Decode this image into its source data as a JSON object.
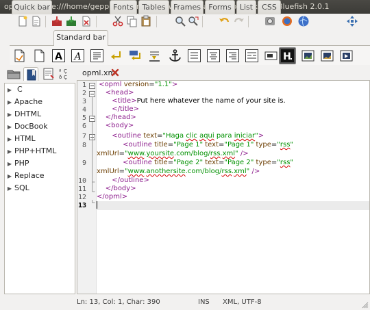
{
  "window": {
    "title": "opml.xml (file:///home/geppettys/Dropbox/WWW/canal9/ncr/opml.xml) - Bluefish 2.0.1"
  },
  "toolbar": {
    "icons": [
      "new-file-icon",
      "open-file-icon",
      "save-icon",
      "save-as-icon",
      "close-file-icon",
      "cut-icon",
      "copy-icon",
      "paste-icon",
      "find-icon",
      "find-replace-icon",
      "undo-icon",
      "redo-icon",
      "preferences-icon",
      "browser-preview-icon",
      "fullscreen-icon"
    ]
  },
  "tabs": [
    {
      "label": "Quick bar"
    },
    {
      "label": "Standard bar"
    },
    {
      "label": "Fonts"
    },
    {
      "label": "Tables"
    },
    {
      "label": "Frames"
    },
    {
      "label": "Forms"
    },
    {
      "label": "List"
    },
    {
      "label": "CSS"
    }
  ],
  "active_tab": "Standard bar",
  "htmlbar": {
    "icons": [
      "quickstart-icon",
      "body-icon",
      "bold-icon",
      "italic-icon",
      "paragraph-icon",
      "break-icon",
      "break-clear-icon",
      "nbsp-icon",
      "anchor-icon",
      "rule-icon",
      "center-icon",
      "right-icon",
      "comment-icon",
      "email-icon",
      "heading-icon",
      "image-icon",
      "thumbnail-icon",
      "div-icon"
    ]
  },
  "side_tabs": [
    "directory-icon",
    "bookmark-icon",
    "snippets-icon",
    "charmap-icon"
  ],
  "sidebar": {
    "items": [
      {
        "label": "C"
      },
      {
        "label": "Apache"
      },
      {
        "label": "DHTML"
      },
      {
        "label": "DocBook"
      },
      {
        "label": "HTML"
      },
      {
        "label": "PHP+HTML"
      },
      {
        "label": "PHP"
      },
      {
        "label": "Replace"
      },
      {
        "label": "SQL"
      }
    ]
  },
  "document": {
    "tab_label": "opml.xml",
    "line_numbers": [
      "1",
      "2",
      "3",
      "4",
      "5",
      "6",
      "7",
      "8",
      "",
      "9",
      "",
      "10",
      "11",
      "12",
      "13"
    ]
  },
  "status": {
    "position": "Ln: 13, Col: 1, Char: 390",
    "mode": "INS",
    "encoding": "XML, UTF-8"
  },
  "colors": {
    "tag": "#8b1a8b",
    "attribute": "#6b3d00",
    "string": "#009100",
    "spellcheck": "#d40000"
  }
}
